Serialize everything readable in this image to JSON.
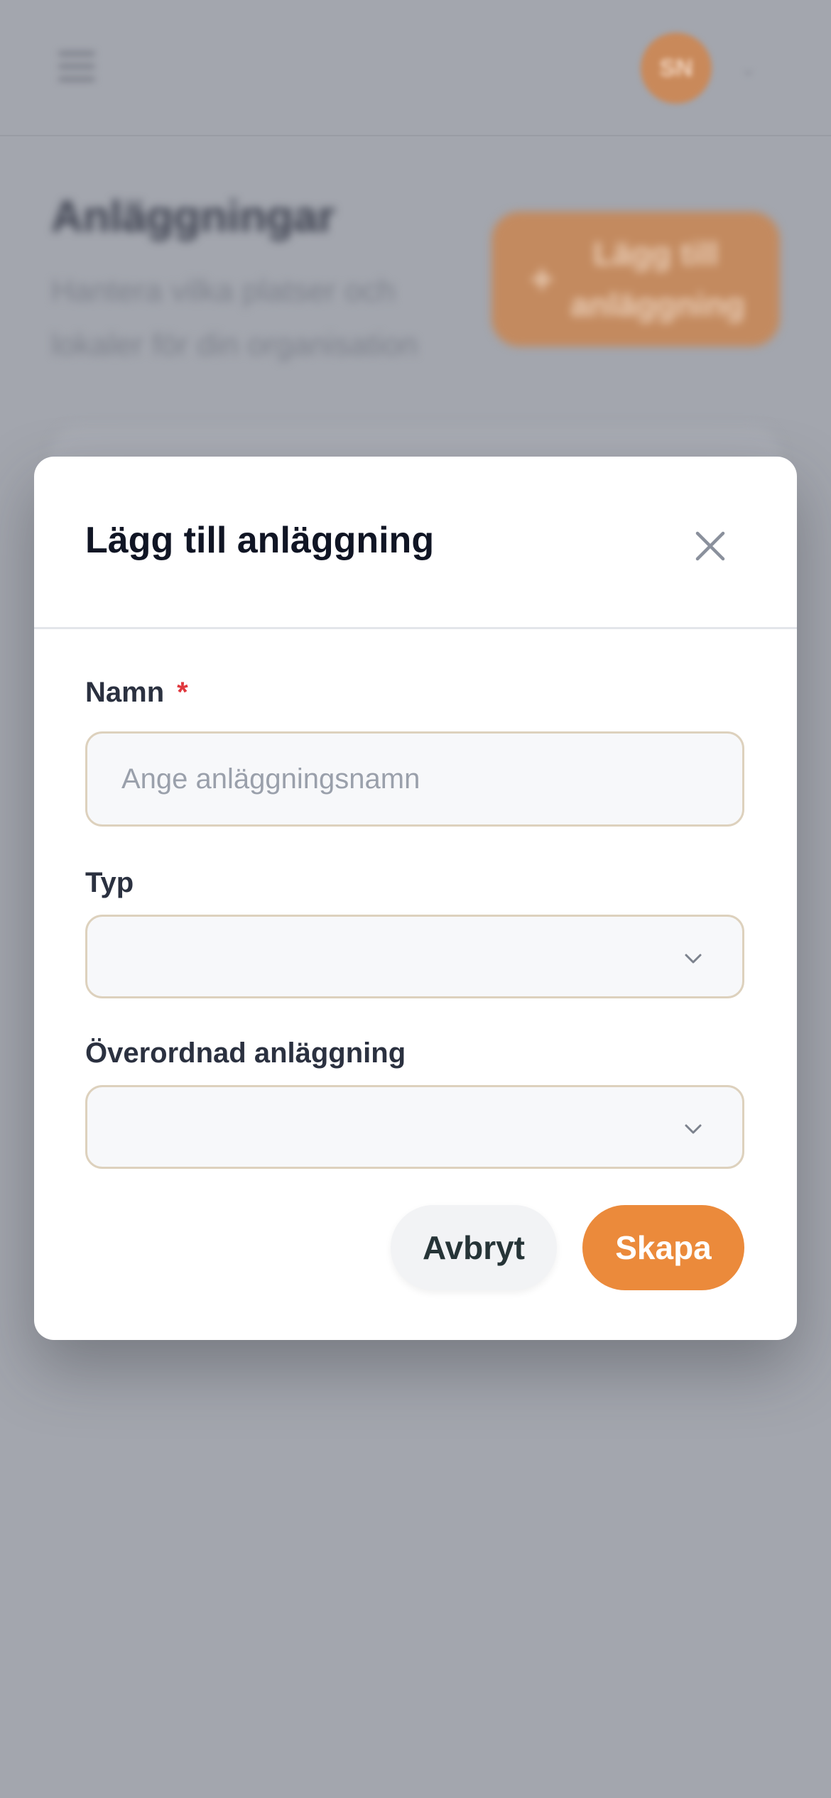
{
  "background": {
    "avatar_initials": "SN",
    "page_title": "Anläggningar",
    "page_subtitle": "Hantera vilka platser och lokaler för din organisation",
    "add_button_label": "Lägg till anläggning"
  },
  "modal": {
    "title": "Lägg till anläggning",
    "name_field": {
      "label": "Namn",
      "required_marker": "*",
      "placeholder": "Ange anläggningsnamn",
      "value": ""
    },
    "type_field": {
      "label": "Typ",
      "selected": ""
    },
    "parent_field": {
      "label": "Överordnad anläggning",
      "selected": ""
    },
    "cancel_label": "Avbryt",
    "create_label": "Skapa"
  },
  "colors": {
    "accent": "#eb8a3b",
    "overlay": "#a3a6ae",
    "input_border": "#ddd1bd",
    "required": "#e0383e"
  },
  "icons": [
    "menu-icon",
    "chevron-down-icon",
    "plus-icon",
    "close-icon"
  ]
}
